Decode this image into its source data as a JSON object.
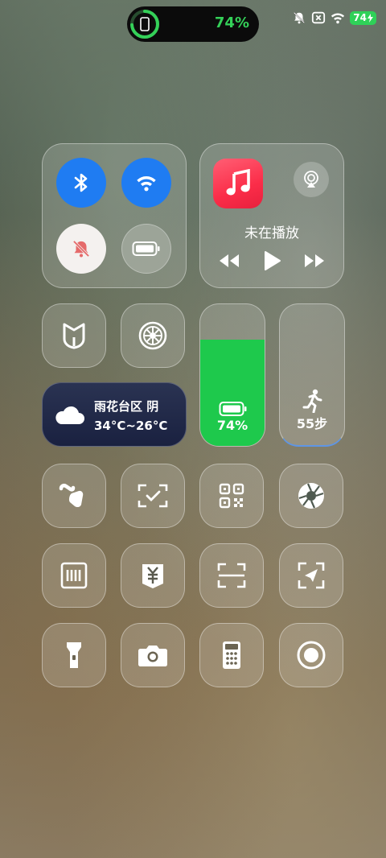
{
  "status_bar": {
    "island_battery_percent": "74%",
    "battery_level_badge": "74",
    "icons": [
      "bell-off-icon",
      "x-box-icon",
      "wifi-icon",
      "battery-charging-icon"
    ]
  },
  "connectivity": {
    "bluetooth": {
      "icon": "bluetooth-icon",
      "state": "on"
    },
    "wifi": {
      "icon": "wifi-icon",
      "state": "on"
    },
    "silent": {
      "icon": "bell-off-icon",
      "state": "on"
    },
    "battery_saver": {
      "icon": "battery-icon",
      "state": "off"
    }
  },
  "media": {
    "app_icon": "music-note-icon",
    "now_playing": "未在播放",
    "controls": [
      "rewind-icon",
      "play-icon",
      "fast-forward-icon"
    ]
  },
  "shortcuts_row1": [
    "mi-home-icon",
    "gear-icon"
  ],
  "weather": {
    "city": "雨花台区 阴",
    "temp": "34°C~26°C",
    "icon": "cloud-icon"
  },
  "battery_tile": {
    "label": "74%",
    "level": 0.74,
    "color": "#1ec94c"
  },
  "steps_tile": {
    "label": "55步",
    "icon": "running-icon"
  },
  "grid": [
    [
      "brush-icon",
      "scan-check-icon",
      "qr-code-icon",
      "aperture-icon"
    ],
    [
      "nfc-card-icon",
      "payment-icon",
      "scan-icon",
      "screenshot-icon"
    ],
    [
      "flashlight-icon",
      "camera-icon",
      "calculator-icon",
      "record-icon"
    ]
  ],
  "colors": {
    "accent_blue": "#1f7cf2",
    "battery_green": "#1ec94c",
    "music_red": "#fb2d49"
  }
}
